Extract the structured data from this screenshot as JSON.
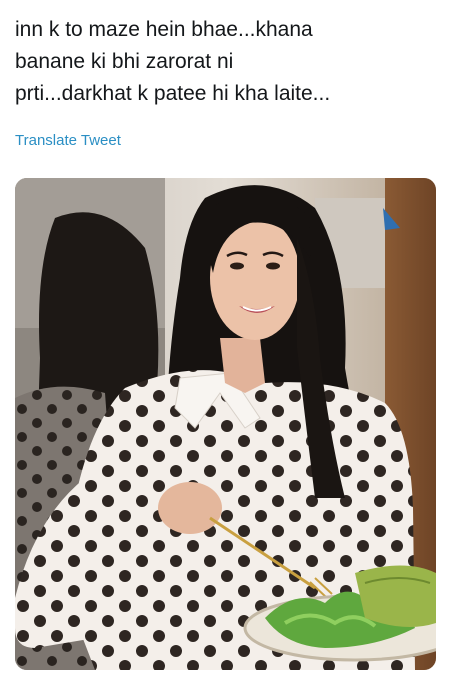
{
  "tweet": {
    "text": "inn k to maze hein bhae...khana\nbanane ki bhi zarorat ni\nprti...darkhat k patee hi kha laite...",
    "translate_label": "Translate Tweet"
  },
  "media": {
    "alt": "photo"
  }
}
